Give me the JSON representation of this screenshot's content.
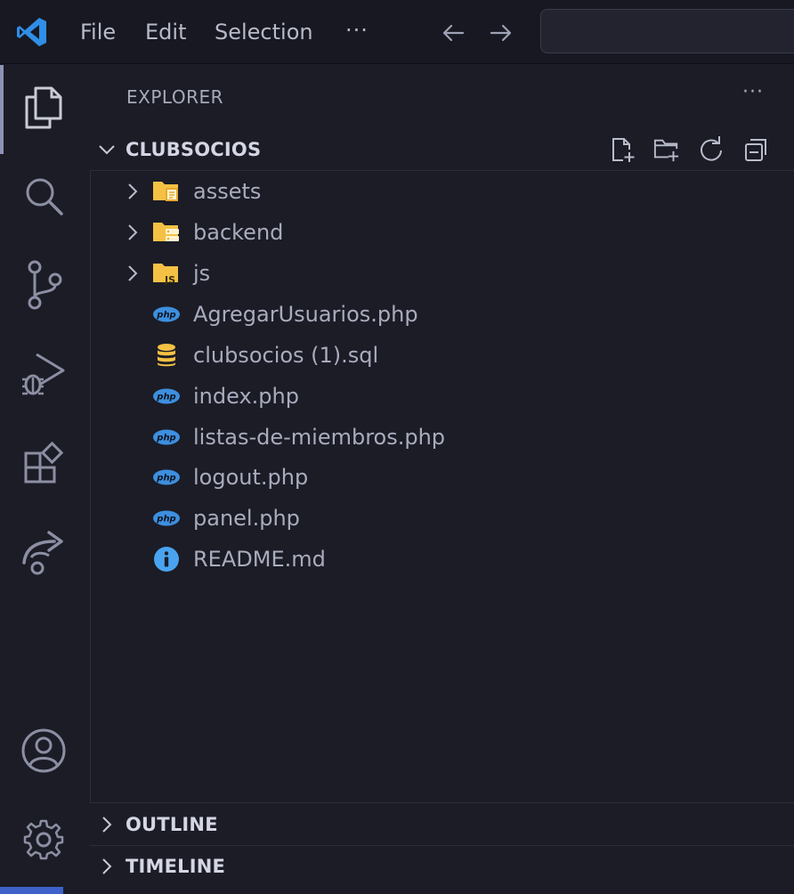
{
  "menu": {
    "file": "File",
    "edit": "Edit",
    "selection": "Selection",
    "more": "···"
  },
  "explorer": {
    "title": "EXPLORER",
    "more": "···",
    "project_name": "CLUBSOCIOS"
  },
  "tree": [
    {
      "name": "assets",
      "kind": "folder",
      "icon": "folder-assets-icon"
    },
    {
      "name": "backend",
      "kind": "folder",
      "icon": "folder-backend-icon"
    },
    {
      "name": "js",
      "kind": "folder",
      "icon": "folder-js-icon"
    },
    {
      "name": "AgregarUsuarios.php",
      "kind": "file",
      "icon": "php-icon"
    },
    {
      "name": "clubsocios (1).sql",
      "kind": "file",
      "icon": "database-icon"
    },
    {
      "name": "index.php",
      "kind": "file",
      "icon": "php-icon"
    },
    {
      "name": "listas-de-miembros.php",
      "kind": "file",
      "icon": "php-icon"
    },
    {
      "name": "logout.php",
      "kind": "file",
      "icon": "php-icon"
    },
    {
      "name": "panel.php",
      "kind": "file",
      "icon": "php-icon"
    },
    {
      "name": "README.md",
      "kind": "file",
      "icon": "info-icon"
    }
  ],
  "panels": {
    "outline": "OUTLINE",
    "timeline": "TIMELINE"
  },
  "colors": {
    "accent_blue": "#2f8ee6",
    "folder_yellow": "#f5c144",
    "php_blue": "#3d8fdf"
  }
}
